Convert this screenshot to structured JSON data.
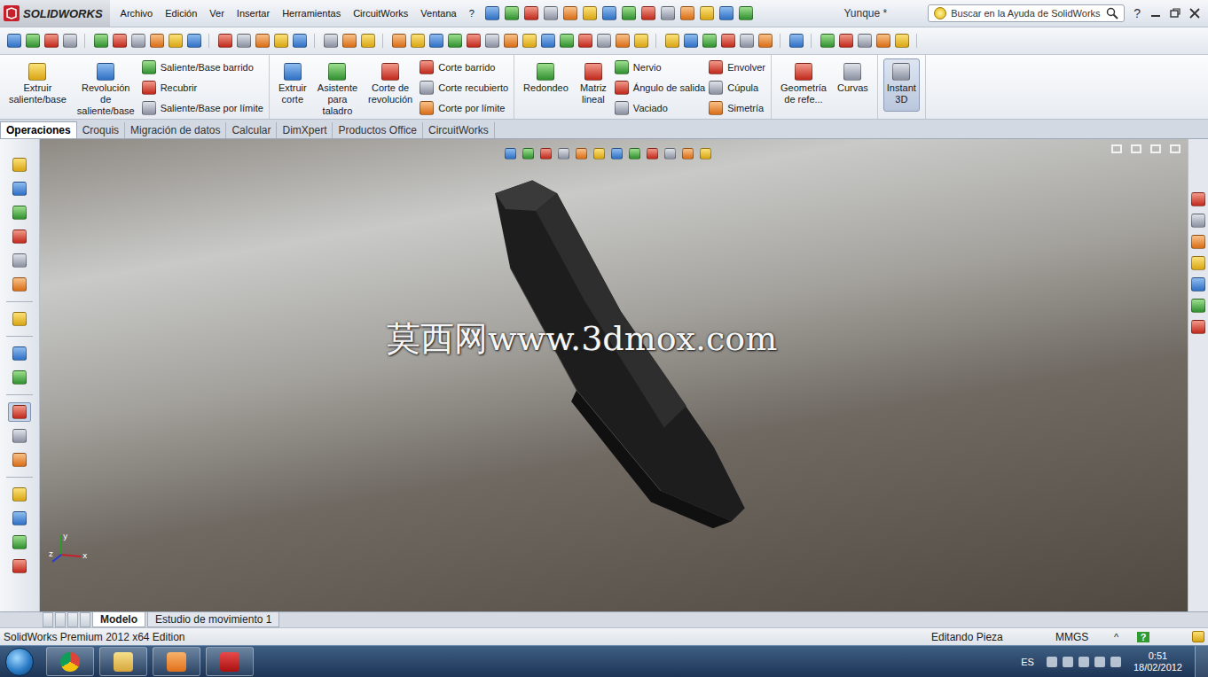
{
  "app": {
    "logo": "SOLIDWORKS",
    "document": "Yunque *"
  },
  "menu": [
    "Archivo",
    "Edición",
    "Ver",
    "Insertar",
    "Herramientas",
    "CircuitWorks",
    "Ventana",
    "?"
  ],
  "search": {
    "placeholder": "Buscar en la Ayuda de SolidWorks"
  },
  "help": "?",
  "ribbon": {
    "groups": [
      [
        {
          "kind": "large",
          "label": "Extruir saliente/base",
          "selected": false
        },
        {
          "kind": "large",
          "label": "Revolución de saliente/base",
          "selected": false
        },
        {
          "kind": "stack",
          "items": [
            "Saliente/Base barrido",
            "Recubrir",
            "Saliente/Base por límite"
          ]
        }
      ],
      [
        {
          "kind": "large",
          "label": "Extruir corte",
          "selected": false
        },
        {
          "kind": "large",
          "label": "Asistente para taladro",
          "selected": false
        },
        {
          "kind": "large",
          "label": "Corte de revolución",
          "selected": false
        },
        {
          "kind": "stack",
          "items": [
            "Corte barrido",
            "Corte recubierto",
            "Corte por límite"
          ]
        }
      ],
      [
        {
          "kind": "large",
          "label": "Redondeo",
          "selected": false
        },
        {
          "kind": "large",
          "label": "Matriz lineal",
          "selected": false
        },
        {
          "kind": "stack",
          "items": [
            "Nervio",
            "Ángulo de salida",
            "Vaciado"
          ]
        },
        {
          "kind": "stack",
          "items": [
            "Envolver",
            "Cúpula",
            "Simetría"
          ]
        }
      ],
      [
        {
          "kind": "large",
          "label": "Geometría de refe...",
          "selected": false
        },
        {
          "kind": "large",
          "label": "Curvas",
          "selected": false
        }
      ],
      [
        {
          "kind": "large",
          "label": "Instant 3D",
          "selected": true
        }
      ]
    ]
  },
  "tabs": [
    {
      "label": "Operaciones",
      "selected": true
    },
    {
      "label": "Croquis",
      "selected": false
    },
    {
      "label": "Migración de datos",
      "selected": false
    },
    {
      "label": "Calcular",
      "selected": false
    },
    {
      "label": "DimXpert",
      "selected": false
    },
    {
      "label": "Productos Office",
      "selected": false
    },
    {
      "label": "CircuitWorks",
      "selected": false
    }
  ],
  "left_toolbar": [
    {
      "selected": false
    },
    {
      "selected": false
    },
    {
      "selected": false
    },
    {
      "selected": false
    },
    {
      "selected": false
    },
    {
      "selected": false
    },
    {
      "selected": false
    },
    {
      "selected": false
    },
    {
      "selected": false
    },
    {
      "selected": true
    },
    {
      "selected": false
    },
    {
      "selected": false
    },
    {
      "selected": false
    },
    {
      "selected": false
    },
    {
      "selected": false
    },
    {
      "selected": false
    }
  ],
  "viewport": {
    "watermark": "莫西网www.3dmox.com",
    "axes": [
      "x",
      "y",
      "z"
    ]
  },
  "bottom_tabs": [
    {
      "label": "Modelo",
      "selected": true
    },
    {
      "label": "Estudio de movimiento 1",
      "selected": false
    }
  ],
  "status_bar": {
    "edition": "SolidWorks Premium 2012 x64 Edition",
    "mode": "Editando Pieza",
    "units": "MMGS",
    "units_menu": "^",
    "help": "?"
  },
  "taskbar": {
    "language": "ES",
    "time": "0:51",
    "date": "18/02/2012"
  }
}
